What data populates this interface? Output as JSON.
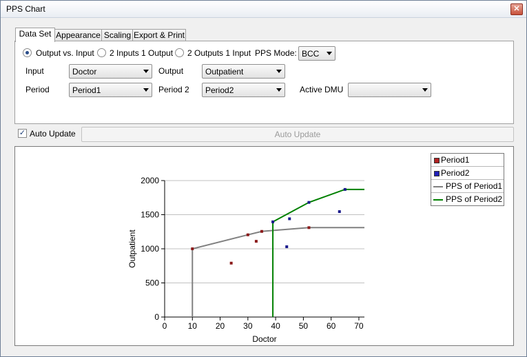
{
  "window": {
    "title": "PPS Chart"
  },
  "tabs": [
    {
      "label": "Data Set",
      "active": true
    },
    {
      "label": "Appearance",
      "active": false
    },
    {
      "label": "Scaling",
      "active": false
    },
    {
      "label": "Export & Print",
      "active": false
    }
  ],
  "dataset": {
    "modes": [
      {
        "label": "Output vs. Input",
        "checked": true
      },
      {
        "label": "2 Inputs 1 Output",
        "checked": false
      },
      {
        "label": "2 Outputs 1 Input",
        "checked": false
      }
    ],
    "pps_mode_label": "PPS Mode:",
    "pps_mode_value": "BCC",
    "input_label": "Input",
    "input_value": "Doctor",
    "output_label": "Output",
    "output_value": "Outpatient",
    "period_label": "Period",
    "period_value": "Period1",
    "period2_label": "Period 2",
    "period2_value": "Period2",
    "active_dmu_label": "Active DMU",
    "active_dmu_value": ""
  },
  "auto_update": {
    "checkbox_label": "Auto Update",
    "checked": true,
    "button_label": "Auto Update",
    "button_enabled": false
  },
  "colors": {
    "period1": "#8b1a1a",
    "period2": "#1a1a8c",
    "pps1": "#808080",
    "pps2": "#008000"
  },
  "chart_data": {
    "type": "scatter",
    "xlabel": "Doctor",
    "ylabel": "Outpatient",
    "xlim": [
      0,
      72
    ],
    "ylim": [
      0,
      2000
    ],
    "xticks": [
      0,
      10,
      20,
      30,
      40,
      50,
      60,
      70
    ],
    "yticks": [
      0,
      500,
      1000,
      1500,
      2000
    ],
    "grid": "horizontal",
    "legend_position": "top-right",
    "series": [
      {
        "name": "Period1",
        "kind": "points",
        "points": [
          [
            10,
            1000
          ],
          [
            24,
            790
          ],
          [
            30,
            1205
          ],
          [
            33,
            1110
          ],
          [
            35,
            1255
          ],
          [
            52,
            1310
          ]
        ]
      },
      {
        "name": "Period2",
        "kind": "points",
        "points": [
          [
            39,
            1395
          ],
          [
            44,
            1030
          ],
          [
            45,
            1440
          ],
          [
            52,
            1680
          ],
          [
            63,
            1545
          ],
          [
            65,
            1870
          ]
        ]
      },
      {
        "name": "PPS of Period1",
        "kind": "line",
        "points": [
          [
            10,
            0
          ],
          [
            10,
            1000
          ],
          [
            30,
            1205
          ],
          [
            35,
            1255
          ],
          [
            52,
            1310
          ],
          [
            72,
            1310
          ]
        ]
      },
      {
        "name": "PPS of Period2",
        "kind": "line",
        "points": [
          [
            39,
            0
          ],
          [
            39,
            1395
          ],
          [
            52,
            1680
          ],
          [
            65,
            1870
          ],
          [
            72,
            1870
          ]
        ]
      }
    ]
  }
}
